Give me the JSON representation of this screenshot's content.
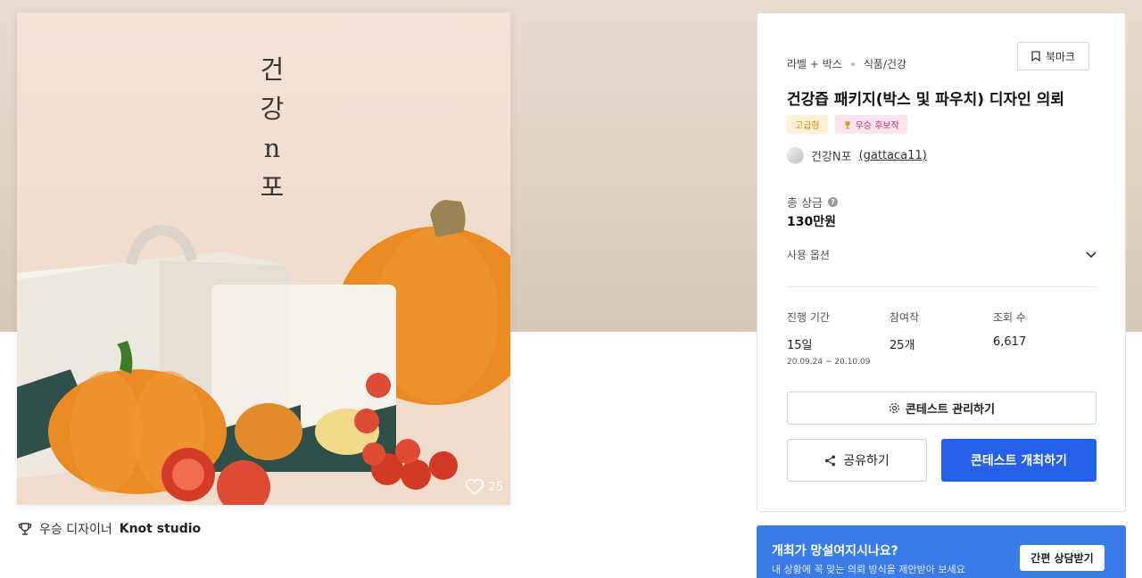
{
  "product": {
    "brand_lines": [
      "건",
      "강",
      "n",
      "포"
    ],
    "pouch_brand_lines": [
      "건",
      "강",
      "n",
      "포"
    ],
    "like_count": "25",
    "winner_label": "우승 디자이너",
    "winner_name": "Knot studio"
  },
  "panel": {
    "category_1": "라벨 + 박스",
    "category_2": "식품/건강",
    "bookmark_label": "북마크",
    "title": "건강즙 패키지(박스 및 파우치) 디자인 의뢰",
    "badge_premium": "고급형",
    "badge_candidate": "우승 후보작",
    "host_name": "건강N포",
    "host_id": "(gattaca11)",
    "prize_label": "총 상금",
    "prize_value": "130만원",
    "options_label": "사용 옵션",
    "stats": {
      "period_label": "진행 기간",
      "period_value": "15일",
      "period_range": "20.09.24 ~ 20.10.09",
      "entries_label": "참여작",
      "entries_value": "25개",
      "views_label": "조회 수",
      "views_value": "6,617"
    },
    "manage_label": "콘테스트 관리하기",
    "share_label": "공유하기",
    "host_label": "콘테스트 개최하기"
  },
  "consult": {
    "heading": "개최가 망설여지시나요?",
    "sub": "내 상황에 꼭 맞는 의뢰 방식을 제안받아 보세요",
    "button": "간편 상담받기"
  },
  "colors": {
    "accent": "#2460e8",
    "consult_bg": "#3a7bea",
    "hero_bg": "#e2d4c4",
    "premium_badge": "#fff1d6",
    "candidate_badge": "#fde4ef"
  }
}
